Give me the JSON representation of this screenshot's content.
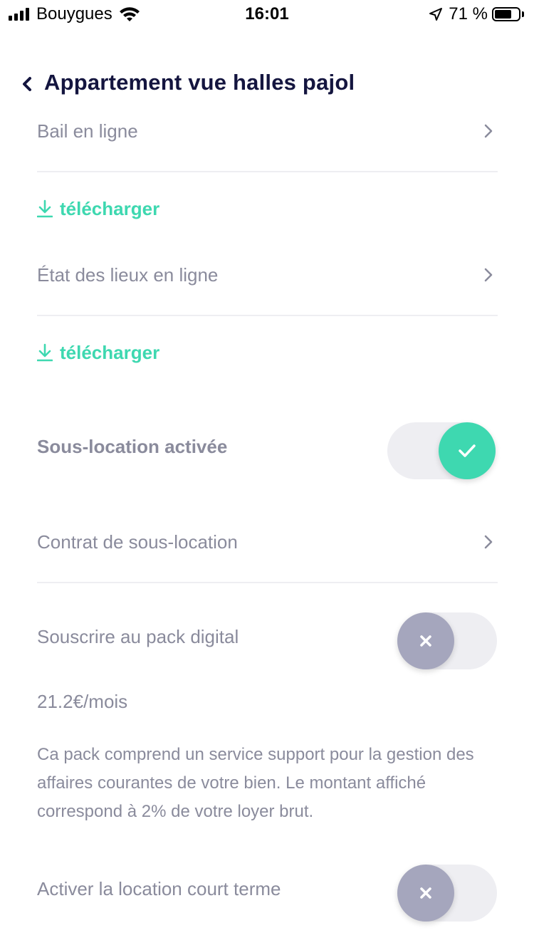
{
  "status_bar": {
    "carrier": "Bouygues",
    "time": "16:01",
    "battery": "71 %",
    "battery_level": 0.71
  },
  "header": {
    "title": "Appartement vue halles pajol"
  },
  "rows": {
    "bail": {
      "label": "Bail en ligne"
    },
    "bail_download": {
      "label": "télécharger"
    },
    "etat": {
      "label": "État des lieux en ligne"
    },
    "etat_download": {
      "label": "télécharger"
    },
    "sous_location": {
      "label": "Sous-location activée",
      "enabled": true
    },
    "contrat": {
      "label": "Contrat de sous-location"
    },
    "pack_digital": {
      "label": "Souscrire au pack digital",
      "enabled": false
    },
    "price": "21.2€/mois",
    "description": "Ca pack comprend un service support pour la gestion des affaires courantes de votre bien. Le montant affiché correspond à 2% de votre loyer brut.",
    "court_terme": {
      "label": "Activer la location court terme",
      "enabled": false
    }
  },
  "colors": {
    "accent": "#3ed8b0",
    "title": "#14153f",
    "text": "#8a8b9c",
    "toggle_off_knob": "#a5a6bd",
    "toggle_track": "#eeeef2"
  },
  "icons": {
    "back": "chevron-left-icon",
    "chevron": "chevron-right-icon",
    "download": "download-icon",
    "check": "check-icon",
    "close": "close-icon",
    "wifi": "wifi-icon",
    "location": "location-arrow-icon"
  }
}
